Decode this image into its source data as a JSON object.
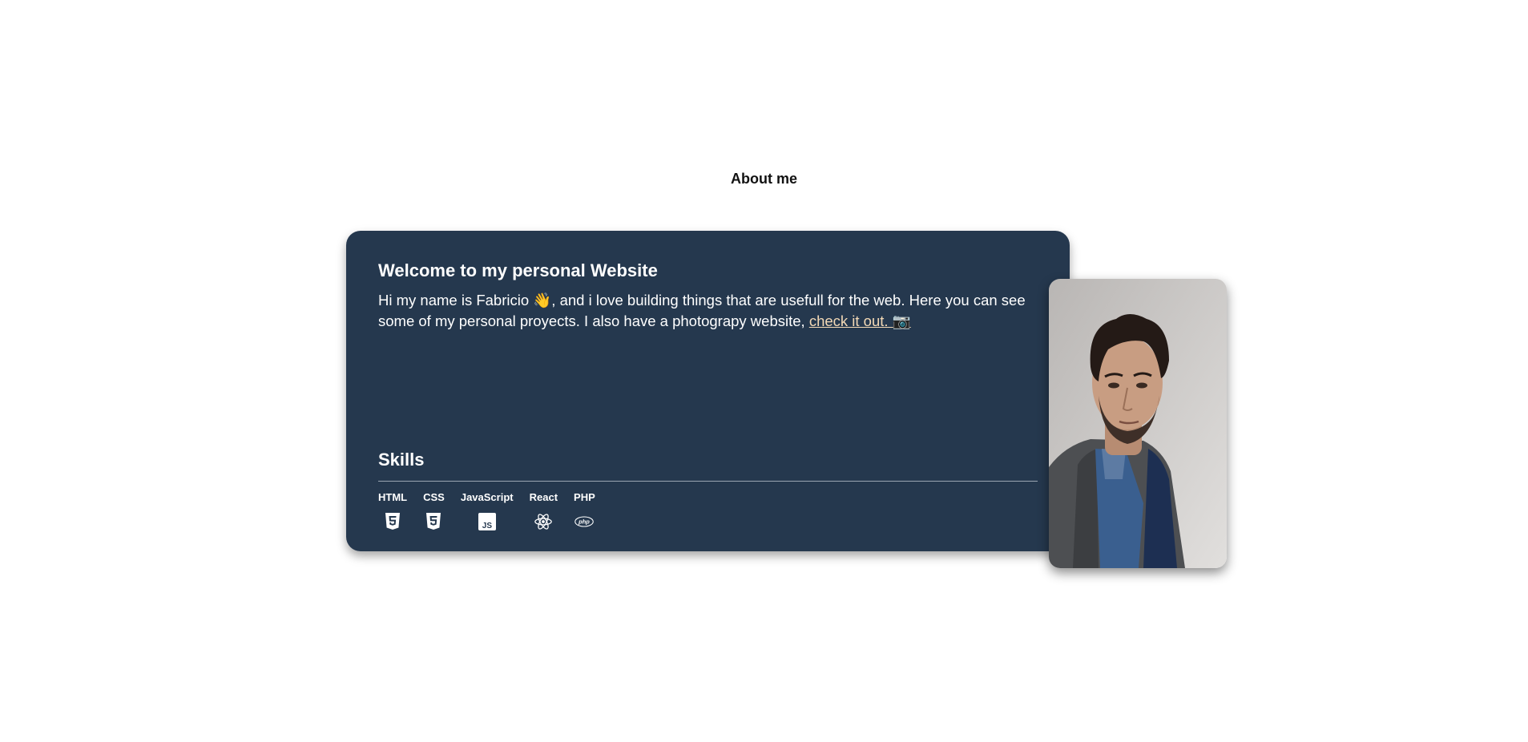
{
  "section": {
    "title": "About me"
  },
  "card": {
    "title": "Welcome to my personal Website",
    "intro_text": "Hi my name is Fabricio 👋, and i love building things that are usefull for the web. Here you can see some of my personal proyects. I also have a photograpy website, ",
    "link_text": "check it out. 📷"
  },
  "skills": {
    "title": "Skills",
    "items": [
      {
        "label": "HTML",
        "icon": "html5-icon"
      },
      {
        "label": "CSS",
        "icon": "css3-icon"
      },
      {
        "label": "JavaScript",
        "icon": "javascript-icon"
      },
      {
        "label": "React",
        "icon": "react-icon"
      },
      {
        "label": "PHP",
        "icon": "php-icon"
      }
    ]
  },
  "colors": {
    "card_background": "#25384e",
    "link": "#f3d9b6",
    "text": "#ffffff"
  }
}
